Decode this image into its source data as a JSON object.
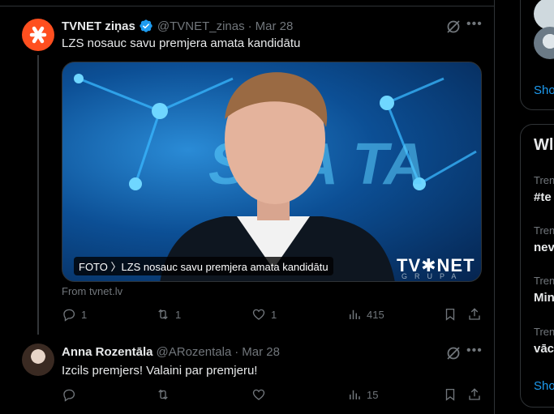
{
  "tweet1": {
    "name": "TVNET ziņas",
    "handle": "@TVNET_zinas",
    "separator": "·",
    "date": "Mar 28",
    "text": "LZS nosauc savu premjera amata kandidātu",
    "media_caption": "FOTO 〉LZS nosauc savu premjera amata kandidātu",
    "media_logo": "TV✱NET",
    "media_logo_sub": "GRUPA",
    "source": "From tvnet.lv",
    "actions": {
      "replies": "1",
      "reposts": "1",
      "likes": "1",
      "views": "415"
    }
  },
  "tweet2": {
    "name": "Anna Rozentāla",
    "handle": "@ARozentala",
    "separator": "·",
    "date": "Mar 28",
    "text": "Izcils premjers! Valaini par premjeru!",
    "actions": {
      "replies": "",
      "reposts": "",
      "likes": "",
      "views": "15"
    }
  },
  "sidebar": {
    "show_more_1": "Sho",
    "section_title": "Wl",
    "trends": [
      {
        "label": "Trend",
        "name": "#te"
      },
      {
        "label": "Trend",
        "name": "nev"
      },
      {
        "label": "Trend",
        "name": "Min"
      },
      {
        "label": "Trend",
        "name": "vāc"
      }
    ],
    "show_more_2": "Sho"
  },
  "colors": {
    "accent": "#1d9bf0",
    "tvnet_brand": "#ff4f1f",
    "muted": "#71767b"
  }
}
